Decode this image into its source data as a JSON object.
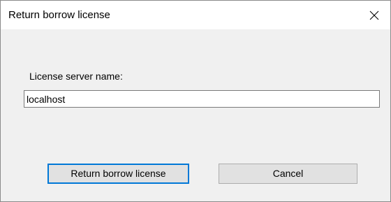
{
  "dialog": {
    "title": "Return borrow license",
    "close_icon": "close-icon"
  },
  "form": {
    "server_label": "License server name:",
    "server_value": "localhost"
  },
  "buttons": {
    "return_label": "Return borrow license",
    "cancel_label": "Cancel"
  },
  "colors": {
    "focus_border": "#0078d7",
    "dialog_bg": "#f0f0f0",
    "titlebar_bg": "#ffffff"
  }
}
